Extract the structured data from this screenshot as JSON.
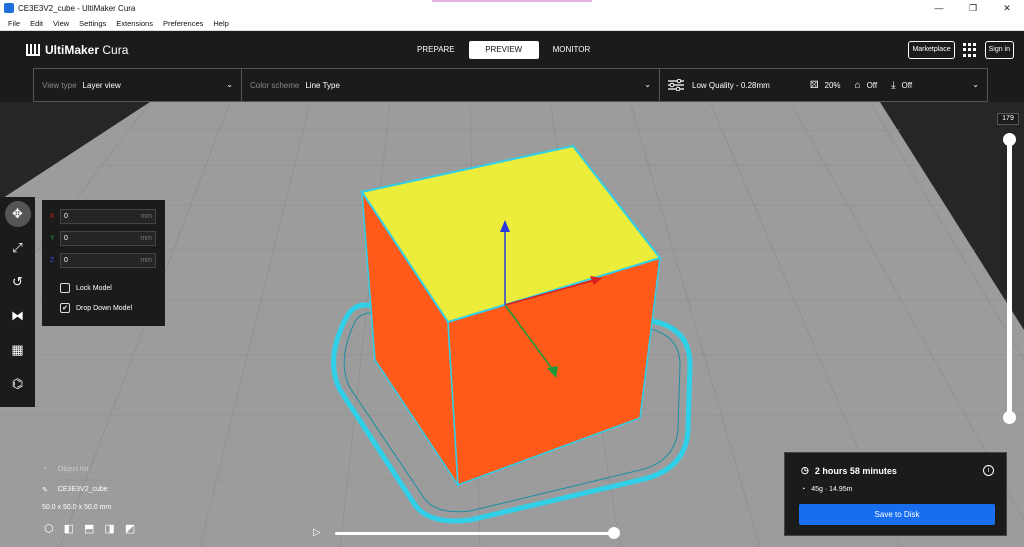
{
  "window": {
    "title": "CE3E3V2_cube - UltiMaker Cura",
    "controls": [
      "—",
      "❐",
      "✕"
    ]
  },
  "menu": [
    "File",
    "Edit",
    "View",
    "Settings",
    "Extensions",
    "Preferences",
    "Help"
  ],
  "header": {
    "logo_text_bold": "UltiMaker",
    "logo_text": "Cura",
    "stages": [
      "PREPARE",
      "PREVIEW",
      "MONITOR"
    ],
    "active_stage": "PREVIEW",
    "marketplace": "Marketplace",
    "sign_in": "Sign in"
  },
  "view_settings": {
    "view_type_label": "View type",
    "view_type_value": "Layer view",
    "color_scheme_label": "Color scheme",
    "color_scheme_value": "Line Type"
  },
  "print_settings": {
    "profile": "Low Quality - 0.28mm",
    "infill": "20%",
    "support": "Off",
    "adhesion": "Off"
  },
  "translate_panel": {
    "x_label": "X",
    "x_value": "0",
    "y_label": "Y",
    "y_value": "0",
    "z_label": "Z",
    "z_value": "0",
    "unit": "mm",
    "lock_model": "Lock Model",
    "drop_down_model": "Drop Down Model",
    "lock_checked": false,
    "drop_checked": true
  },
  "side_tools": [
    "move-icon",
    "scale-icon",
    "rotate-icon",
    "mirror-icon",
    "per-model-settings-icon",
    "support-blocker-icon"
  ],
  "layer_slider": {
    "current_layer": "179"
  },
  "object_list": {
    "title": "Object list",
    "object_name": "CE3E3V2_cube",
    "dimensions": "50.0 x 50.0 x 50.0 mm"
  },
  "estimate": {
    "time": "2 hours 58 minutes",
    "material": "45g · 14.95m",
    "save_button": "Save to Disk"
  },
  "colors": {
    "accent": "#196ef0",
    "model_wall": "#ff5a1a",
    "top_skin": "#ecec3a",
    "outer_wall": "#2fd0e8",
    "build_plate": "#9a9a9a"
  }
}
